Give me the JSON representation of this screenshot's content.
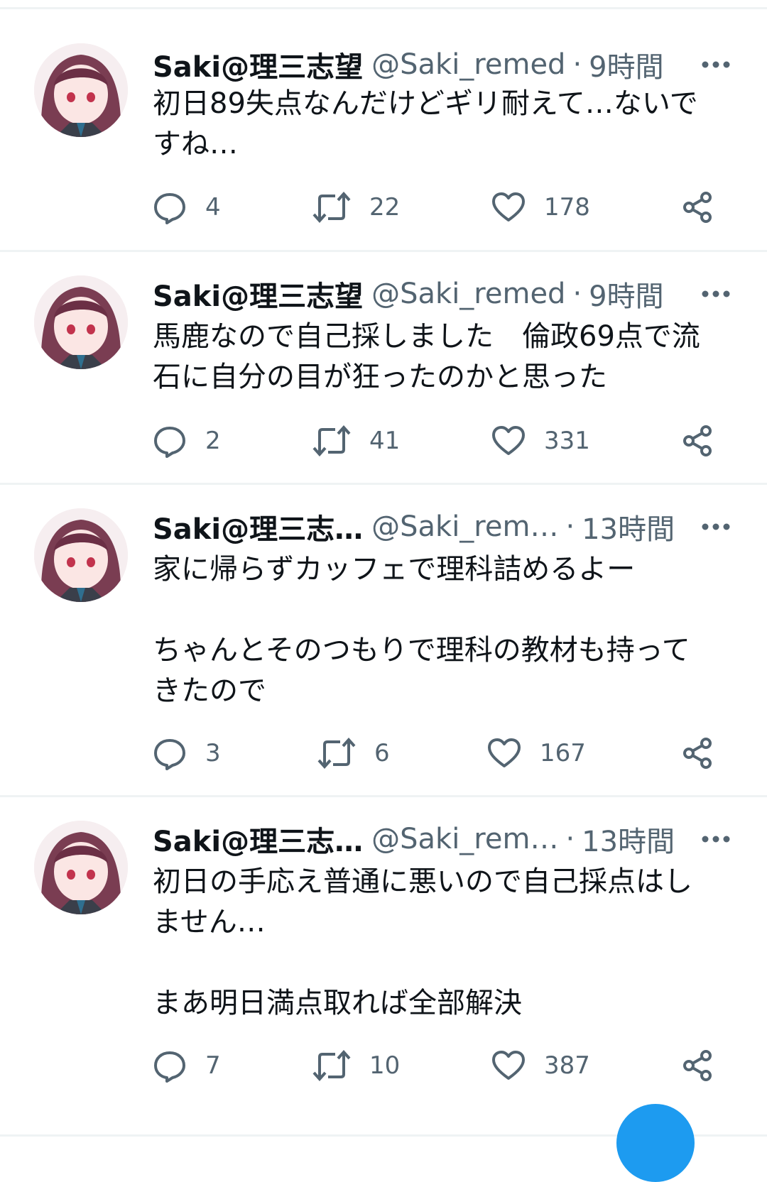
{
  "tweets": [
    {
      "name": "Saki@理三志望",
      "handle": "@Saki_remed",
      "dot": "·",
      "time": "9時間",
      "text": "初日89失点なんだけどギリ耐えて…ないで\nすね…",
      "replies": "4",
      "retweets": "22",
      "likes": "178"
    },
    {
      "name": "Saki@理三志望",
      "handle": "@Saki_remed",
      "dot": "·",
      "time": "9時間",
      "text": "馬鹿なので自己採しました　倫政69点で流\n石に自分の目が狂ったのかと思った",
      "replies": "2",
      "retweets": "41",
      "likes": "331"
    },
    {
      "name": "Saki@理三志…",
      "handle": "@Saki_rem…",
      "dot": "·",
      "time": "13時間",
      "text": "家に帰らずカッフェで理科詰めるよー\n\nちゃんとそのつもりで理科の教材も持って\nきたので",
      "replies": "3",
      "retweets": "6",
      "likes": "167"
    },
    {
      "name": "Saki@理三志…",
      "handle": "@Saki_rem…",
      "dot": "·",
      "time": "13時間",
      "text": "初日の手応え普通に悪いので自己採点はし\nません…\n\nまあ明日満点取れば全部解決",
      "replies": "7",
      "retweets": "10",
      "likes": "387"
    }
  ],
  "icons": {
    "reply": "reply-icon",
    "retweet": "retweet-icon",
    "like": "heart-icon",
    "share": "share-icon",
    "more": "more-icon"
  },
  "colors": {
    "text": "#0f1419",
    "secondary": "#536471",
    "divider": "#eff3f4",
    "accent": "#1d9bf0"
  }
}
